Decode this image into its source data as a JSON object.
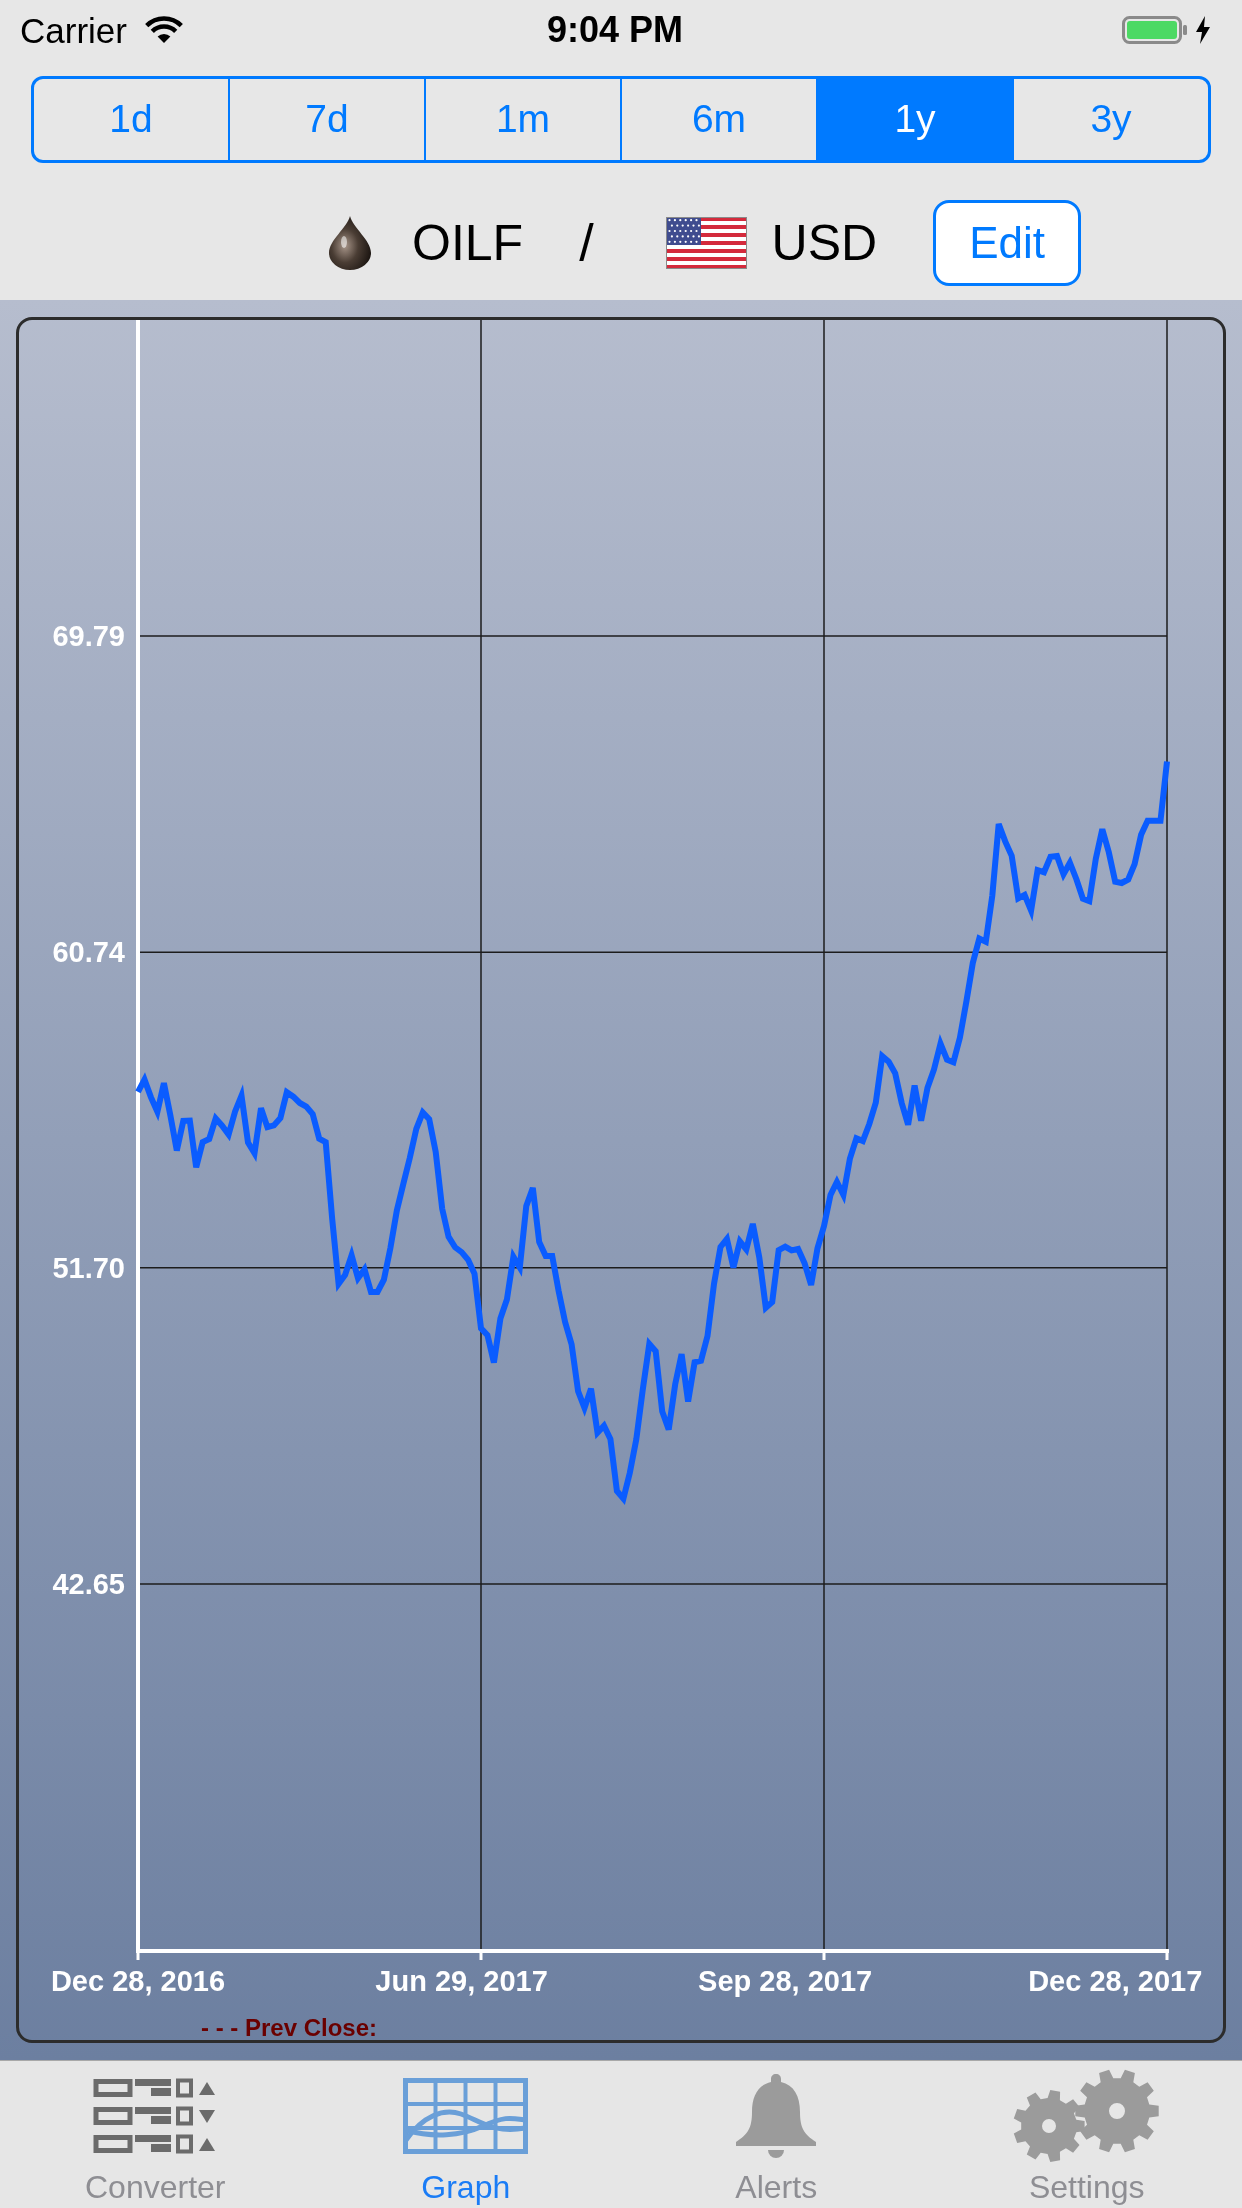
{
  "status_bar": {
    "carrier": "Carrier",
    "time": "9:04 PM"
  },
  "range_tabs": [
    {
      "label": "1d",
      "selected": false
    },
    {
      "label": "7d",
      "selected": false
    },
    {
      "label": "1m",
      "selected": false
    },
    {
      "label": "6m",
      "selected": false
    },
    {
      "label": "1y",
      "selected": true
    },
    {
      "label": "3y",
      "selected": false
    }
  ],
  "pair": {
    "base": "OILF",
    "separator": "/",
    "quote": "USD",
    "edit_button": "Edit"
  },
  "chart": {
    "prev_close_label": "- - - Prev Close:",
    "chart_data": {
      "type": "line",
      "grid": true,
      "ylim": [
        32.14,
        78.84
      ],
      "yticks": [
        {
          "value": 42.65,
          "label": "42.65"
        },
        {
          "value": 51.7,
          "label": "51.70"
        },
        {
          "value": 60.74,
          "label": "60.74"
        },
        {
          "value": 69.79,
          "label": "69.79"
        }
      ],
      "categories": [
        "Dec 28, 2016",
        null,
        null,
        null,
        null,
        null,
        null,
        null,
        null,
        null,
        null,
        null,
        null,
        null,
        null,
        null,
        null,
        null,
        null,
        null,
        null,
        null,
        null,
        null,
        null,
        null,
        null,
        null,
        null,
        null,
        null,
        null,
        null,
        null,
        null,
        null,
        null,
        null,
        null,
        null,
        null,
        null,
        null,
        null,
        null,
        null,
        null,
        null,
        null,
        null,
        "Jun 29, 2017",
        null,
        null,
        null,
        null,
        null,
        null,
        null,
        null,
        null,
        null,
        null,
        null,
        null,
        null,
        null,
        null,
        null,
        null,
        null,
        null,
        null,
        null,
        null,
        null,
        null,
        null,
        null,
        null,
        null,
        null,
        null,
        null,
        null,
        null,
        null,
        null,
        null,
        null,
        null,
        null,
        null,
        null,
        null,
        null,
        null,
        null,
        null,
        null,
        null,
        "Sep 28, 2017",
        null,
        null,
        null,
        null,
        null,
        null,
        null,
        null,
        null,
        null,
        null,
        null,
        null,
        null,
        null,
        null,
        null,
        null,
        null,
        null,
        null,
        null,
        null,
        null,
        null,
        null,
        null,
        null,
        null,
        null,
        null,
        null,
        null,
        null,
        null,
        null,
        null,
        null,
        null,
        null,
        null,
        null,
        null,
        null,
        null,
        null,
        null,
        null,
        null,
        null,
        "Dec 28, 2017",
        null,
        null,
        null,
        null,
        null,
        null,
        null,
        null
      ],
      "series": [
        {
          "color": "#0a5cff",
          "values": [
            56.74,
            57.09,
            56.59,
            56.17,
            56.99,
            56.06,
            55.06,
            55.91,
            55.92,
            54.58,
            55.3,
            55.39,
            55.98,
            55.77,
            55.52,
            56.18,
            56.63,
            55.29,
            54.98,
            56.27,
            55.73,
            55.78,
            55.99,
            56.73,
            56.6,
            56.42,
            56.32,
            56.1,
            55.4,
            55.3,
            53.1,
            51.24,
            51.5,
            52.06,
            51.4,
            51.66,
            51.01,
            51.01,
            51.36,
            52.27,
            53.35,
            54.1,
            54.85,
            55.68,
            56.15,
            55.96,
            55.02,
            53.39,
            52.59,
            52.29,
            52.15,
            51.93,
            51.53,
            49.97,
            49.77,
            48.99,
            50.25,
            50.79,
            52.02,
            51.71,
            53.47,
            53.99,
            52.44,
            52.04,
            52.04,
            51.03,
            50.15,
            49.51,
            48.17,
            47.69,
            48.24,
            46.98,
            47.18,
            46.8,
            45.31,
            45.09,
            45.83,
            46.79,
            48.22,
            49.52,
            49.31,
            47.59,
            47.07,
            48.37,
            49.23,
            47.87,
            49.0,
            49.04,
            49.75,
            51.24,
            52.3,
            52.53,
            51.71,
            52.46,
            52.23,
            52.96,
            52.0,
            50.56,
            50.72,
            52.21,
            52.31,
            52.2,
            52.24,
            51.83,
            51.21,
            52.26,
            52.9,
            53.79,
            54.16,
            53.79,
            54.83,
            55.41,
            55.33,
            55.82,
            56.43,
            57.76,
            57.6,
            57.27,
            56.42,
            55.8,
            56.92,
            55.91,
            56.86,
            57.38,
            58.12,
            57.66,
            57.59,
            58.29,
            59.33,
            60.43,
            61.13,
            61.04,
            62.36,
            64.41,
            63.91,
            63.5,
            62.28,
            62.38,
            61.93,
            63.09,
            63.03,
            63.47,
            63.49,
            62.97,
            63.3,
            62.83,
            62.27,
            62.2,
            63.41,
            64.26,
            63.6,
            62.76,
            62.72,
            62.82,
            63.26,
            64.1,
            64.5,
            64.5,
            64.5,
            66.2
          ]
        }
      ]
    }
  },
  "tab_bar": [
    {
      "label": "Converter",
      "selected": false
    },
    {
      "label": "Graph",
      "selected": true
    },
    {
      "label": "Alerts",
      "selected": false
    },
    {
      "label": "Settings",
      "selected": false
    }
  ]
}
